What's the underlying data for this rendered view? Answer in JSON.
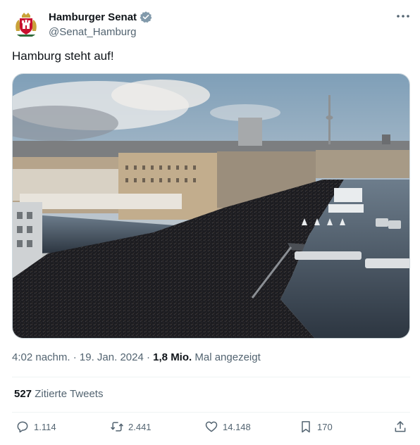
{
  "author": {
    "display_name": "Hamburger Senat",
    "handle": "@Senat_Hamburg"
  },
  "tweet": {
    "text": "Hamburg steht auf!",
    "time": "4:02 nachm.",
    "date": "19. Jan. 2024",
    "views_count": "1,8 Mio.",
    "views_label": "Mal angezeigt",
    "separator": "·"
  },
  "stats": {
    "quote_count": "527",
    "quote_label": "Zitierte Tweets"
  },
  "actions": {
    "replies": "1.114",
    "retweets": "2.441",
    "likes": "14.148",
    "bookmarks": "170"
  },
  "colors": {
    "text": "#0f1419",
    "secondary": "#536471",
    "verified_badge": "#829aab",
    "divider": "#eff3f4"
  },
  "icons": [
    "coat-of-arms-avatar",
    "verified-icon",
    "more-icon",
    "reply-icon",
    "retweet-icon",
    "like-icon",
    "bookmark-icon",
    "share-icon"
  ]
}
